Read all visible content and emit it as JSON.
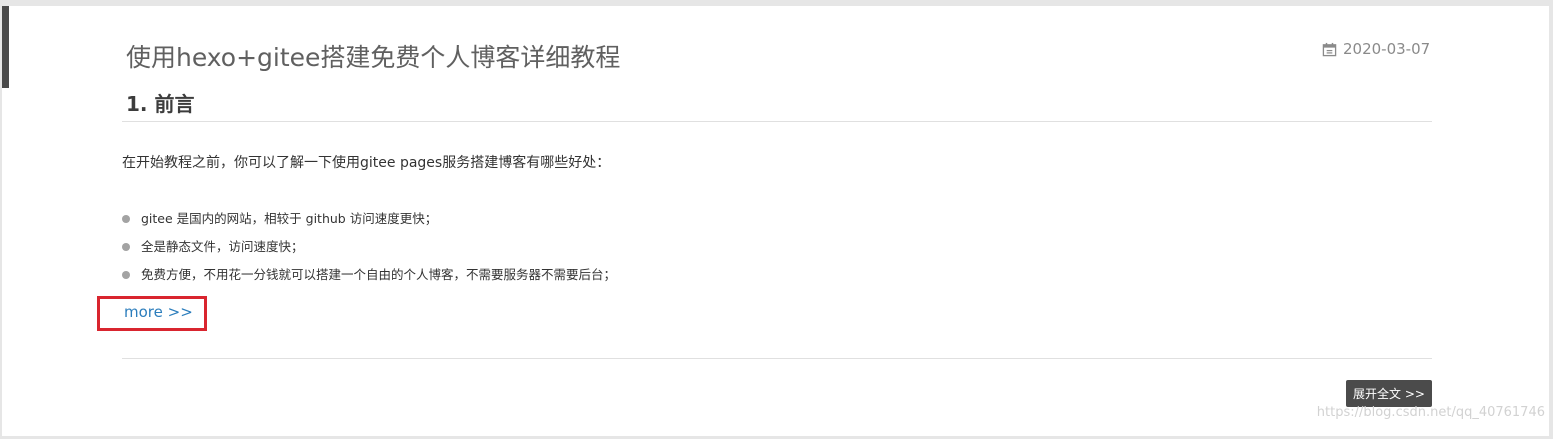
{
  "post": {
    "title": "使用hexo+gitee搭建免费个人博客详细教程",
    "date": "2020-03-07",
    "date_icon": "calendar-icon",
    "section_heading": "1. 前言",
    "intro": "在开始教程之前，你可以了解一下使用gitee pages服务搭建博客有哪些好处：",
    "bullets": [
      "gitee 是国内的网站，相较于 github 访问速度更快；",
      "全是静态文件，访问速度快；",
      "免费方便，不用花一分钱就可以搭建一个自由的个人博客，不需要服务器不需要后台；"
    ],
    "more_label": "more >>",
    "expand_label": "展开全文 >>"
  },
  "watermark": "https://blog.csdn.net/qq_40761746",
  "colors": {
    "accent_bar": "#4a4a4a",
    "link": "#2b7dbc",
    "highlight_box": "#d9252f",
    "button_bg": "#4b4b4b"
  }
}
